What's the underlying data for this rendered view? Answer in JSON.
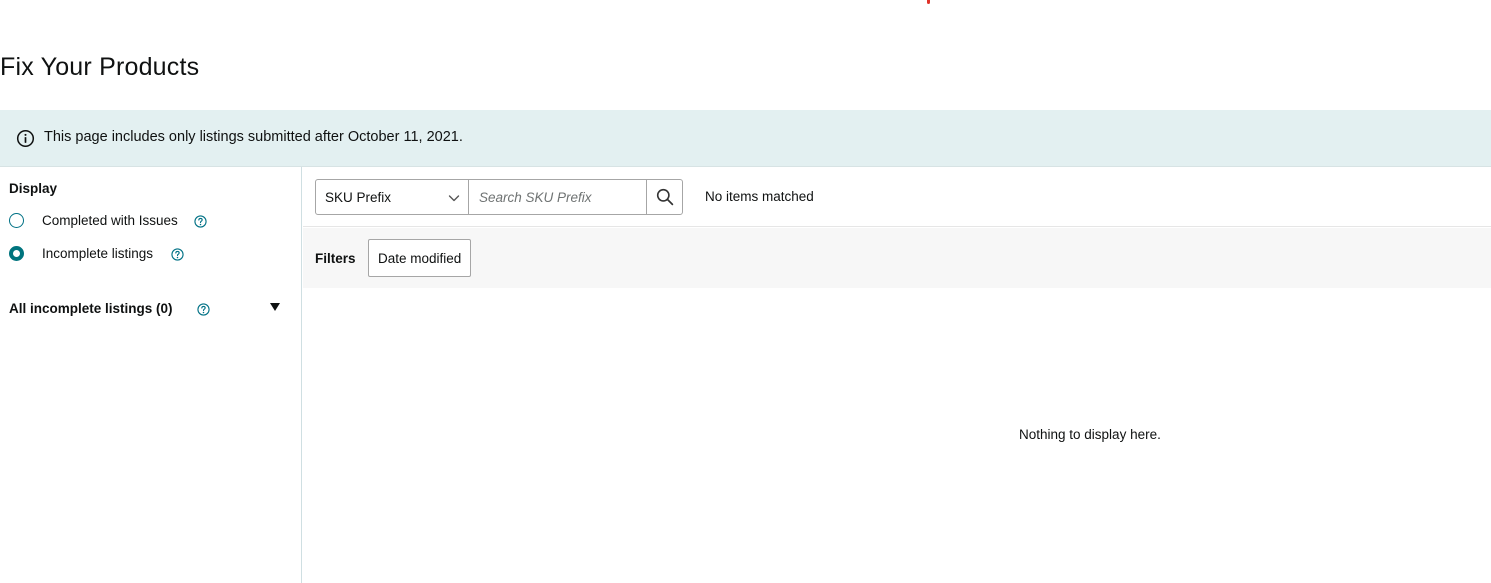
{
  "page": {
    "title": "Fix Your Products"
  },
  "banner": {
    "icon": "info-icon",
    "text": "This page includes only listings submitted after October 11, 2021."
  },
  "sidebar": {
    "display_label": "Display",
    "options": [
      {
        "label": "Completed with Issues",
        "checked": false,
        "help_icon": "help-icon"
      },
      {
        "label": "Incomplete listings",
        "checked": true,
        "help_icon": "help-icon"
      }
    ],
    "section_label": "All incomplete listings (0)",
    "section_icons": [
      "help-icon",
      "caret-down-icon"
    ]
  },
  "search": {
    "select_value": "SKU Prefix",
    "input_value": "",
    "input_placeholder": "Search SKU Prefix",
    "button_icon": "search-icon",
    "result_text": "No items matched"
  },
  "filters": {
    "label": "Filters",
    "buttons": [
      "Date modified"
    ]
  },
  "content": {
    "empty_text": "Nothing to display here."
  },
  "colors": {
    "accent": "#007185",
    "banner_bg": "#e3f0f1",
    "filter_bg": "#f7f7f7"
  }
}
